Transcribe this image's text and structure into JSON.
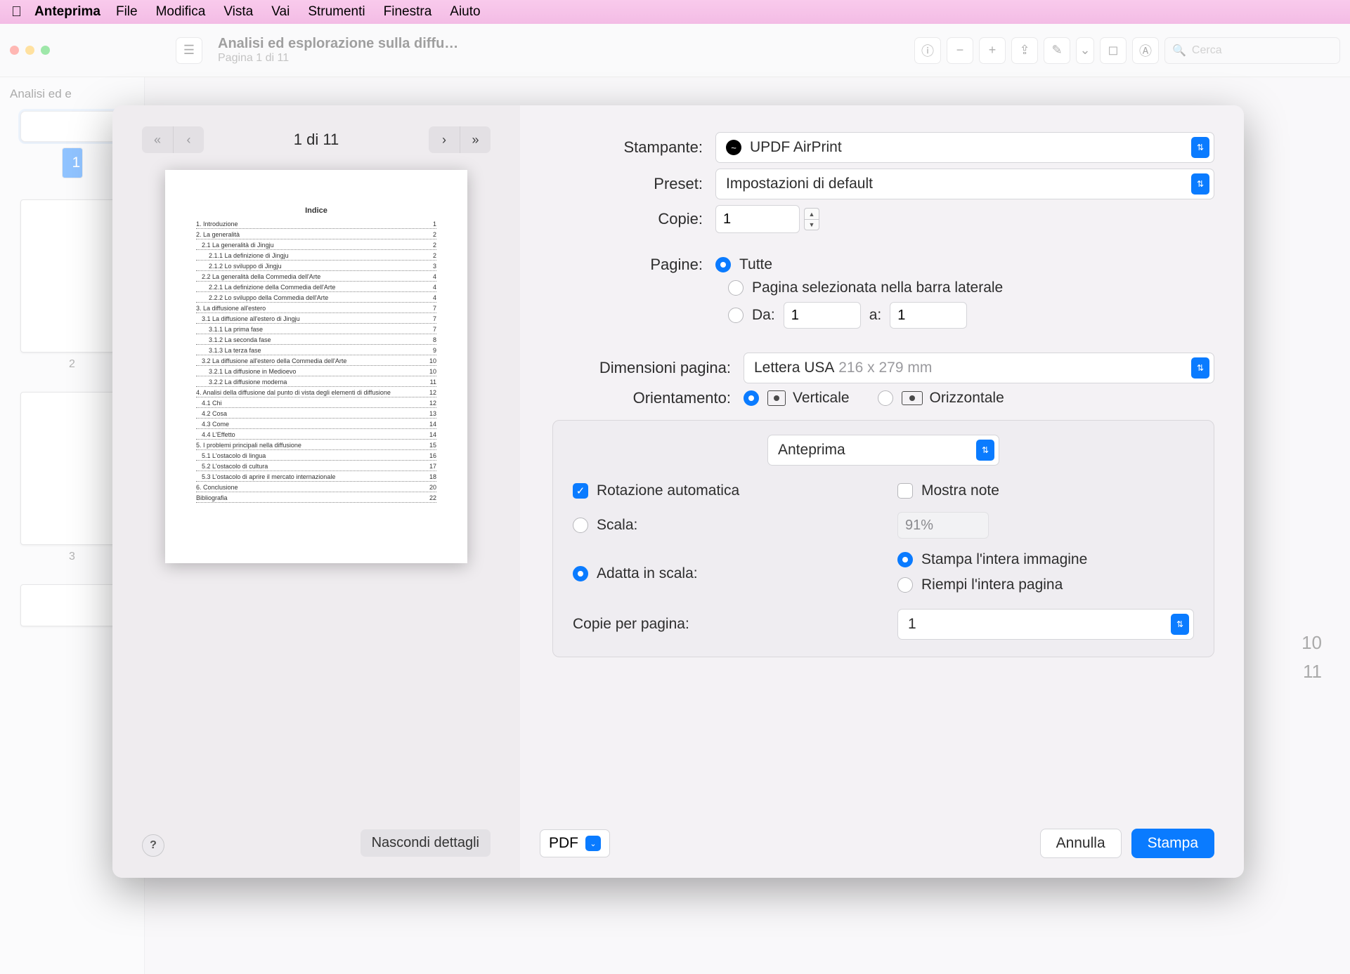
{
  "menubar": {
    "app": "Anteprima",
    "items": [
      "File",
      "Modifica",
      "Vista",
      "Vai",
      "Strumenti",
      "Finestra",
      "Aiuto"
    ]
  },
  "window": {
    "title": "Analisi ed esplorazione sulla diffu…",
    "subtitle": "Pagina 1 di 11",
    "search_placeholder": "Cerca",
    "sidebar_title": "Analisi ed e",
    "thumb_numbers": [
      "1",
      "2",
      "3"
    ],
    "bg_lines": [
      "3.2.1 La diffusione in Medioevo",
      "3.2.2 La diffusione moderna"
    ],
    "bg_pages": [
      "10",
      "11"
    ]
  },
  "dialog": {
    "page_indicator": "1 di 11",
    "toc_title": "Indice",
    "toc": [
      {
        "t": "1. Introduzione",
        "p": "1",
        "i": 0
      },
      {
        "t": "2. La generalità",
        "p": "2",
        "i": 0
      },
      {
        "t": "2.1 La generalità di Jingju",
        "p": "2",
        "i": 1
      },
      {
        "t": "2.1.1 La definizione di Jingju",
        "p": "2",
        "i": 2
      },
      {
        "t": "2.1.2 Lo sviluppo di Jingju",
        "p": "3",
        "i": 2
      },
      {
        "t": "2.2 La generalità della Commedia dell'Arte",
        "p": "4",
        "i": 1
      },
      {
        "t": "2.2.1 La definizione della Commedia dell'Arte",
        "p": "4",
        "i": 2
      },
      {
        "t": "2.2.2 Lo sviluppo della Commedia dell'Arte",
        "p": "4",
        "i": 2
      },
      {
        "t": "3. La diffusione all'estero",
        "p": "7",
        "i": 0
      },
      {
        "t": "3.1 La diffusione all'estero di Jingju",
        "p": "7",
        "i": 1
      },
      {
        "t": "3.1.1 La prima fase",
        "p": "7",
        "i": 2
      },
      {
        "t": "3.1.2 La seconda fase",
        "p": "8",
        "i": 2
      },
      {
        "t": "3.1.3 La terza fase",
        "p": "9",
        "i": 2
      },
      {
        "t": "3.2 La diffusione all'estero della Commedia dell'Arte",
        "p": "10",
        "i": 1
      },
      {
        "t": "3.2.1 La diffusione in Medioevo",
        "p": "10",
        "i": 2
      },
      {
        "t": "3.2.2 La diffusione moderna",
        "p": "11",
        "i": 2
      },
      {
        "t": "4. Analisi della diffusione dal punto di vista degli elementi di diffusione",
        "p": "12",
        "i": 0
      },
      {
        "t": "4.1 Chi",
        "p": "12",
        "i": 1
      },
      {
        "t": "4.2 Cosa",
        "p": "13",
        "i": 1
      },
      {
        "t": "4.3 Come",
        "p": "14",
        "i": 1
      },
      {
        "t": "4.4 L'Effetto",
        "p": "14",
        "i": 1
      },
      {
        "t": "5. I problemi principali nella diffusione",
        "p": "15",
        "i": 0
      },
      {
        "t": "5.1 L'ostacolo di lingua",
        "p": "16",
        "i": 1
      },
      {
        "t": "5.2 L'ostacolo di cultura",
        "p": "17",
        "i": 1
      },
      {
        "t": "5.3 L'ostacolo di aprire il mercato internazionale",
        "p": "18",
        "i": 1
      },
      {
        "t": "6. Conclusione",
        "p": "20",
        "i": 0
      },
      {
        "t": "Bibliografia",
        "p": "22",
        "i": 0
      }
    ],
    "help": "?",
    "hide_details": "Nascondi dettagli",
    "labels": {
      "printer": "Stampante:",
      "preset": "Preset:",
      "copies": "Copie:",
      "pages": "Pagine:",
      "all": "Tutte",
      "selected_sidebar": "Pagina selezionata nella barra laterale",
      "from": "Da:",
      "to": "a:",
      "paper_size": "Dimensioni pagina:",
      "orientation": "Orientamento:",
      "portrait": "Verticale",
      "landscape": "Orizzontale",
      "section": "Anteprima",
      "auto_rotate": "Rotazione automatica",
      "show_notes": "Mostra note",
      "scale": "Scala:",
      "scale_to_fit": "Adatta in scala:",
      "print_entire": "Stampa l'intera immagine",
      "fill_paper": "Riempi l'intera pagina",
      "copies_per_page": "Copie per pagina:"
    },
    "values": {
      "printer": "UPDF AirPrint",
      "preset": "Impostazioni di default",
      "copies": "1",
      "from": "1",
      "to": "1",
      "paper_name": "Lettera USA",
      "paper_dims": "216 x 279 mm",
      "scale_pct": "91%",
      "copies_per_page": "1"
    },
    "footer": {
      "pdf": "PDF",
      "cancel": "Annulla",
      "print": "Stampa"
    }
  }
}
